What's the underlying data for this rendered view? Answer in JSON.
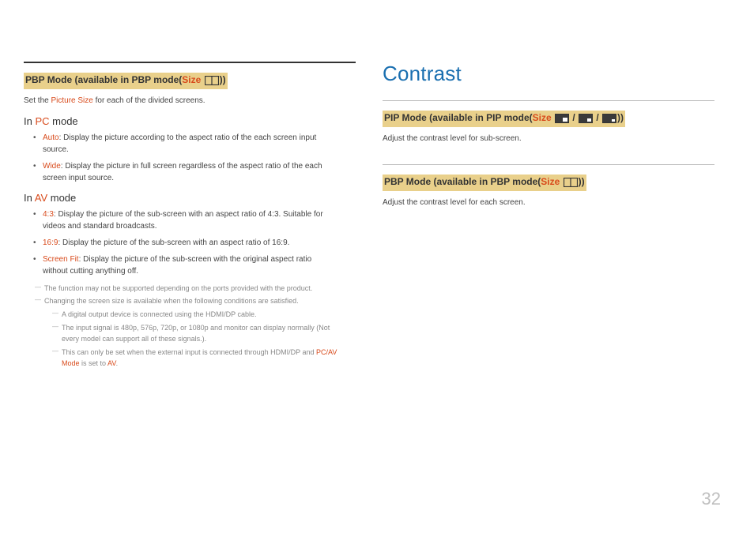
{
  "pageNumber": "32",
  "left": {
    "heading": {
      "prefix": "PBP Mode (available in PBP mode(",
      "size": "Size",
      "suffix": "))"
    },
    "intro": {
      "pre": "Set the ",
      "red": "Picture Size",
      "post": " for each of the divided screens."
    },
    "pc": {
      "heading": {
        "pre": "In ",
        "red": "PC",
        "post": " mode"
      },
      "items": [
        {
          "term": "Auto",
          "text": ": Display the picture according to the aspect ratio of the each screen input source."
        },
        {
          "term": "Wide",
          "text": ": Display the picture in full screen regardless of the aspect ratio of the each screen input source."
        }
      ]
    },
    "av": {
      "heading": {
        "pre": "In ",
        "red": "AV",
        "post": " mode"
      },
      "items": [
        {
          "term": "4:3",
          "text": ": Display the picture of the sub-screen with an aspect ratio of 4:3. Suitable for videos and standard broadcasts."
        },
        {
          "term": "16:9",
          "text": ": Display the picture of the sub-screen with an aspect ratio of 16:9."
        },
        {
          "term": "Screen Fit",
          "text": ": Display the picture of the sub-screen with the original aspect ratio without cutting anything off."
        }
      ]
    },
    "notes": {
      "n1": "The function may not be supported depending on the ports provided with the product.",
      "n2": "Changing the screen size is available when the following conditions are satisfied.",
      "sub": {
        "s1": "A digital output device is connected using the HDMI/DP cable.",
        "s2": "The input signal is 480p, 576p, 720p, or 1080p and monitor can display normally (Not every model can support all of these signals.).",
        "s3": {
          "pre": "This can only be set when the external input is connected through HDMI/DP and ",
          "red1": "PC/AV Mode",
          "mid": " is set to ",
          "red2": "AV",
          "post": "."
        }
      }
    }
  },
  "right": {
    "title": "Contrast",
    "pip": {
      "heading": {
        "prefix": "PIP Mode (available in PIP mode(",
        "size": "Size",
        "suffix": "))"
      },
      "body": "Adjust the contrast level for sub-screen."
    },
    "pbp": {
      "heading": {
        "prefix": "PBP Mode (available in PBP mode(",
        "size": "Size",
        "suffix": "))"
      },
      "body": "Adjust the contrast level for each screen."
    }
  }
}
